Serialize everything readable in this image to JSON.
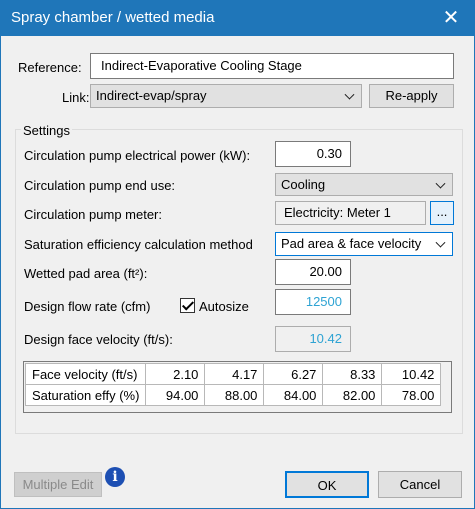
{
  "window": {
    "title": "Spray chamber / wetted media",
    "close_glyph": "✕"
  },
  "reference": {
    "label": "Reference:",
    "value": "Indirect-Evaporative Cooling Stage"
  },
  "link": {
    "label": "Link:",
    "value": "Indirect-evap/spray",
    "reapply_label": "Re-apply"
  },
  "settings": {
    "group_title": "Settings",
    "pump_power": {
      "label": "Circulation pump electrical power (kW):",
      "value": "0.30"
    },
    "pump_end_use": {
      "label": "Circulation pump end use:",
      "value": "Cooling"
    },
    "pump_meter": {
      "label": "Circulation pump meter:",
      "value": "Electricity: Meter 1",
      "browse_label": "..."
    },
    "sat_method": {
      "label": "Saturation efficiency calculation method",
      "value": "Pad area & face velocity"
    },
    "wetted_area": {
      "label": "Wetted pad area (ft²):",
      "value": "20.00"
    },
    "design_flow": {
      "label": "Design flow rate (cfm)",
      "value": "12500",
      "autosize_label": "Autosize",
      "autosize_checked": true
    },
    "face_velocity": {
      "label": "Design face velocity (ft/s):",
      "value": "10.42"
    },
    "table": {
      "rows": [
        {
          "header": "Face velocity (ft/s)",
          "values": [
            "2.10",
            "4.17",
            "6.27",
            "8.33",
            "10.42"
          ]
        },
        {
          "header": "Saturation effy (%)",
          "values": [
            "94.00",
            "88.00",
            "84.00",
            "82.00",
            "78.00"
          ]
        }
      ]
    }
  },
  "footer": {
    "multiple_edit_label": "Multiple Edit",
    "info_glyph": "i",
    "ok_label": "OK",
    "cancel_label": "Cancel"
  }
}
